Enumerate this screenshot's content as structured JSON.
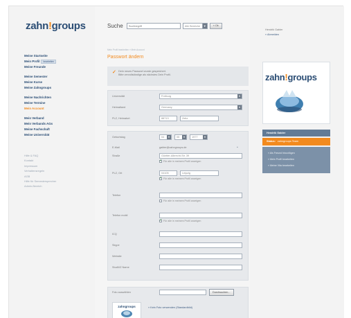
{
  "brand": {
    "name_left": "zahn",
    "name_mark": "!",
    "name_right": "groups"
  },
  "search": {
    "label": "Suche",
    "placeholder": "Suchbegriff",
    "area_value": "Alle Bereiche",
    "ok_label": "» Ok"
  },
  "nav": {
    "main": [
      {
        "label": "Meine Startseite"
      },
      {
        "label": "Mein Profil",
        "badge": "bearbeiten"
      },
      {
        "label": "Meine Freunde"
      }
    ],
    "group2": [
      {
        "label": "Meine Semester"
      },
      {
        "label": "Meine Kurse"
      },
      {
        "label": "Meine Zahngroups"
      }
    ],
    "group3": [
      {
        "label": "Meine Nachrichten"
      },
      {
        "label": "Meine Termine"
      },
      {
        "label": "Mein Account"
      }
    ],
    "group4": [
      {
        "label": "Mein Verband"
      },
      {
        "label": "Mein Verbands AGs"
      },
      {
        "label": "Meine Fachschaft"
      },
      {
        "label": "Meine Universität"
      }
    ],
    "footer": [
      {
        "label": "Hilfe & FAQ"
      },
      {
        "label": "Kontakt"
      },
      {
        "label": "Impressum"
      },
      {
        "label": "Verhaltensregeln"
      },
      {
        "label": "AGB"
      },
      {
        "label": "Hilfe für Semestersprecher"
      },
      {
        "label": "Admin-Bereich"
      }
    ]
  },
  "breadcrumb": "Mein Profil bearbeiten  » Mein Account",
  "page_title": "Passwort ändern",
  "notice": {
    "line1": "Dein neues Passwort wurde gespeichert.",
    "line2": "Bitte vervollständige als nächstes Dein Profil."
  },
  "form1": {
    "uni_label": "Universität",
    "uni_value": "Freiburg",
    "heimatland_label": "Heimatland",
    "heimatland_value": "Germany",
    "plz_label": "PLZ, Heimatort",
    "plz_value": "88713",
    "ort_value": "Zeitz"
  },
  "form2": {
    "geb_label": "Geburtstag",
    "geb_day": "04",
    "geb_month": "05",
    "geb_year": "1977",
    "email_label": "E-Mail",
    "email_value": "gabler@zahngroups.de",
    "strasse_label": "Straße",
    "strasse_value": "Güntter-Albrecht-Str. 39",
    "plzort_label": "PLZ, Ort",
    "plz_value": "04105",
    "ort_value": "Leipzig",
    "telefon_label": "Telefon",
    "mobil_label": "Telefon mobil",
    "icq_label": "ICQ",
    "skype_label": "Skype",
    "website_label": "Website",
    "studivz_label": "StudiVZ Name",
    "show_profile": "Für alle in meinem Profil anzeigen"
  },
  "foto": {
    "label": "Foto auswählen",
    "browse": "Durchsuchen...",
    "kein_foto": "» Kein Foto verwenden (Standardbild)"
  },
  "right": {
    "hello": "Hendrik Gabler",
    "logout": "» Abmelden",
    "user_name": "Hendrik Gabler",
    "status_label": "Status:",
    "status_value": "zahngroups Team",
    "links": [
      {
        "label": "» Als Freund hinzufügen"
      },
      {
        "label": "» Mein Profil bearbeiten"
      },
      {
        "label": "» Meine Vita bearbeiten"
      }
    ]
  },
  "colors": {
    "accent": "#f28a1e",
    "brand_blue": "#2b4d74",
    "panel": "#627b96"
  }
}
